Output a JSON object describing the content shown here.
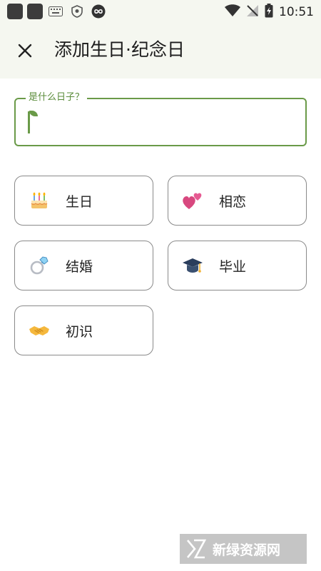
{
  "status_bar": {
    "time": "10:51",
    "icons": [
      "app-square-icon",
      "app-square-icon",
      "keyboard-icon",
      "shield-icon",
      "infinity-icon",
      "wifi-icon",
      "no-signal-icon",
      "battery-icon"
    ]
  },
  "app_bar": {
    "close_icon": "close-icon",
    "title": "添加生日·纪念日"
  },
  "date_name_field": {
    "label": "是什么日子？",
    "value": ""
  },
  "presets": [
    {
      "label": "生日",
      "icon": "birthday-cake-icon"
    },
    {
      "label": "相恋",
      "icon": "two-hearts-icon"
    },
    {
      "label": "结婚",
      "icon": "ring-icon"
    },
    {
      "label": "毕业",
      "icon": "graduation-cap-icon"
    },
    {
      "label": "初识",
      "icon": "handshake-icon"
    }
  ],
  "colors": {
    "accent": "#6a9a48",
    "header_bg": "#f5f7f0",
    "chip_border": "#8a8a8a"
  },
  "watermark": {
    "text": "新绿资源网"
  }
}
